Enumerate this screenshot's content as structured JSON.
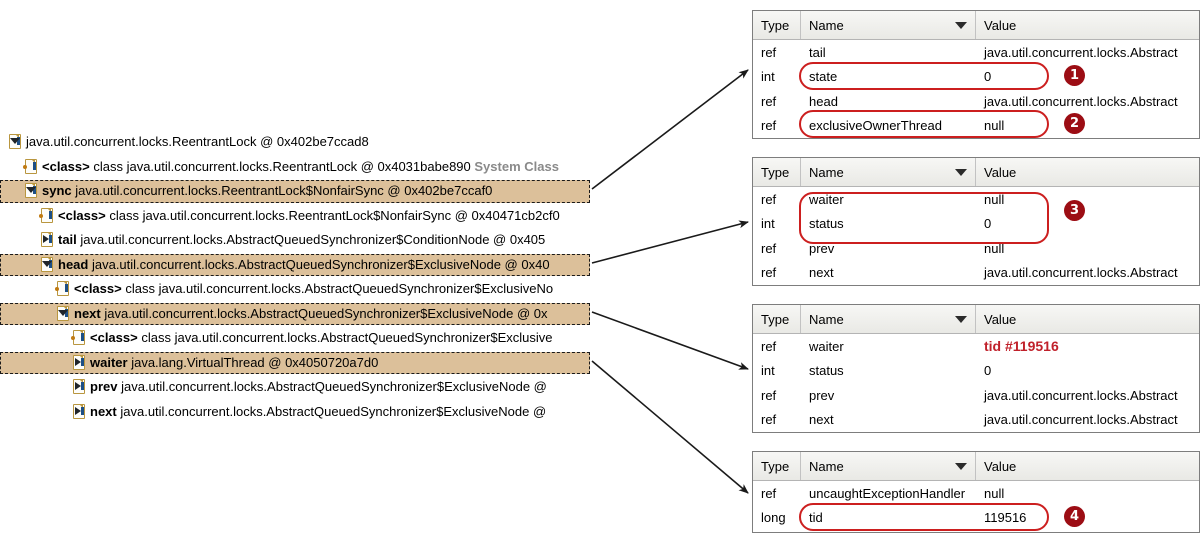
{
  "colors": {
    "selection_bg": "#dcc09a",
    "highlight_red": "#cc1f1f",
    "badge_bg": "#9c0d14",
    "system_class_gray": "#8a8a8a",
    "tid_red": "#c0202a"
  },
  "tree": {
    "rows": [
      {
        "indent": 0,
        "icon": "object-node-icon",
        "expanded": true,
        "label": "",
        "value": "java.util.concurrent.locks.ReentrantLock @ 0x402be7ccad8",
        "selected": false,
        "suffix": ""
      },
      {
        "indent": 1,
        "icon": "class-node-icon",
        "expanded": false,
        "label": "<class>",
        "value": "class java.util.concurrent.locks.ReentrantLock @ 0x4031babe890",
        "selected": false,
        "suffix": "System Class"
      },
      {
        "indent": 1,
        "icon": "object-node-icon",
        "expanded": true,
        "label": "sync",
        "value": "java.util.concurrent.locks.ReentrantLock$NonfairSync @ 0x402be7ccaf0",
        "selected": true,
        "suffix": ""
      },
      {
        "indent": 2,
        "icon": "class-node-icon",
        "expanded": false,
        "label": "<class>",
        "value": "class java.util.concurrent.locks.ReentrantLock$NonfairSync @ 0x40471cb2cf0",
        "selected": false,
        "suffix": ""
      },
      {
        "indent": 2,
        "icon": "ref-node-icon",
        "expanded": false,
        "label": "tail",
        "value": "java.util.concurrent.locks.AbstractQueuedSynchronizer$ConditionNode @ 0x405",
        "selected": false,
        "suffix": ""
      },
      {
        "indent": 2,
        "icon": "object-node-icon",
        "expanded": true,
        "label": "head",
        "value": "java.util.concurrent.locks.AbstractQueuedSynchronizer$ExclusiveNode @ 0x40",
        "selected": true,
        "suffix": ""
      },
      {
        "indent": 3,
        "icon": "class-node-icon",
        "expanded": false,
        "label": "<class>",
        "value": "class java.util.concurrent.locks.AbstractQueuedSynchronizer$ExclusiveNo",
        "selected": false,
        "suffix": ""
      },
      {
        "indent": 3,
        "icon": "object-node-icon",
        "expanded": true,
        "label": "next",
        "value": "java.util.concurrent.locks.AbstractQueuedSynchronizer$ExclusiveNode @ 0x",
        "selected": true,
        "suffix": ""
      },
      {
        "indent": 4,
        "icon": "class-node-icon",
        "expanded": false,
        "label": "<class>",
        "value": "class java.util.concurrent.locks.AbstractQueuedSynchronizer$Exclusive",
        "selected": false,
        "suffix": ""
      },
      {
        "indent": 4,
        "icon": "ref-node-icon",
        "expanded": false,
        "label": "waiter",
        "value": "java.lang.VirtualThread @ 0x4050720a7d0",
        "selected": true,
        "suffix": ""
      },
      {
        "indent": 4,
        "icon": "ref-node-icon",
        "expanded": false,
        "label": "prev",
        "value": "java.util.concurrent.locks.AbstractQueuedSynchronizer$ExclusiveNode @",
        "selected": false,
        "suffix": ""
      },
      {
        "indent": 4,
        "icon": "ref-node-icon",
        "expanded": false,
        "label": "next",
        "value": "java.util.concurrent.locks.AbstractQueuedSynchronizer$ExclusiveNode @",
        "selected": false,
        "suffix": ""
      }
    ]
  },
  "table_headers": {
    "type": "Type",
    "name": "Name",
    "value": "Value"
  },
  "tables": [
    {
      "id": "table-sync",
      "rows": [
        {
          "type": "ref",
          "name": "tail",
          "value": "java.util.concurrent.locks.Abstract"
        },
        {
          "type": "int",
          "name": "state",
          "value": "0"
        },
        {
          "type": "ref",
          "name": "head",
          "value": "java.util.concurrent.locks.Abstract"
        },
        {
          "type": "ref",
          "name": "exclusiveOwnerThread",
          "value": "null"
        }
      ]
    },
    {
      "id": "table-head-node",
      "rows": [
        {
          "type": "ref",
          "name": "waiter",
          "value": "null"
        },
        {
          "type": "int",
          "name": "status",
          "value": "0"
        },
        {
          "type": "ref",
          "name": "prev",
          "value": "null"
        },
        {
          "type": "ref",
          "name": "next",
          "value": "java.util.concurrent.locks.Abstract"
        }
      ]
    },
    {
      "id": "table-next-node",
      "rows": [
        {
          "type": "ref",
          "name": "waiter",
          "value": "tid #119516",
          "value_style": "tid"
        },
        {
          "type": "int",
          "name": "status",
          "value": "0"
        },
        {
          "type": "ref",
          "name": "prev",
          "value": "java.util.concurrent.locks.Abstract"
        },
        {
          "type": "ref",
          "name": "next",
          "value": "java.util.concurrent.locks.Abstract"
        }
      ]
    },
    {
      "id": "table-virtual-thread",
      "rows": [
        {
          "type": "ref",
          "name": "uncaughtExceptionHandler",
          "value": "null"
        },
        {
          "type": "long",
          "name": "tid",
          "value": "119516"
        }
      ]
    }
  ],
  "badges": [
    {
      "number": "1",
      "for": "state"
    },
    {
      "number": "2",
      "for": "exclusiveOwnerThread"
    },
    {
      "number": "3",
      "for": "waiter-status"
    },
    {
      "number": "4",
      "for": "tid"
    }
  ]
}
